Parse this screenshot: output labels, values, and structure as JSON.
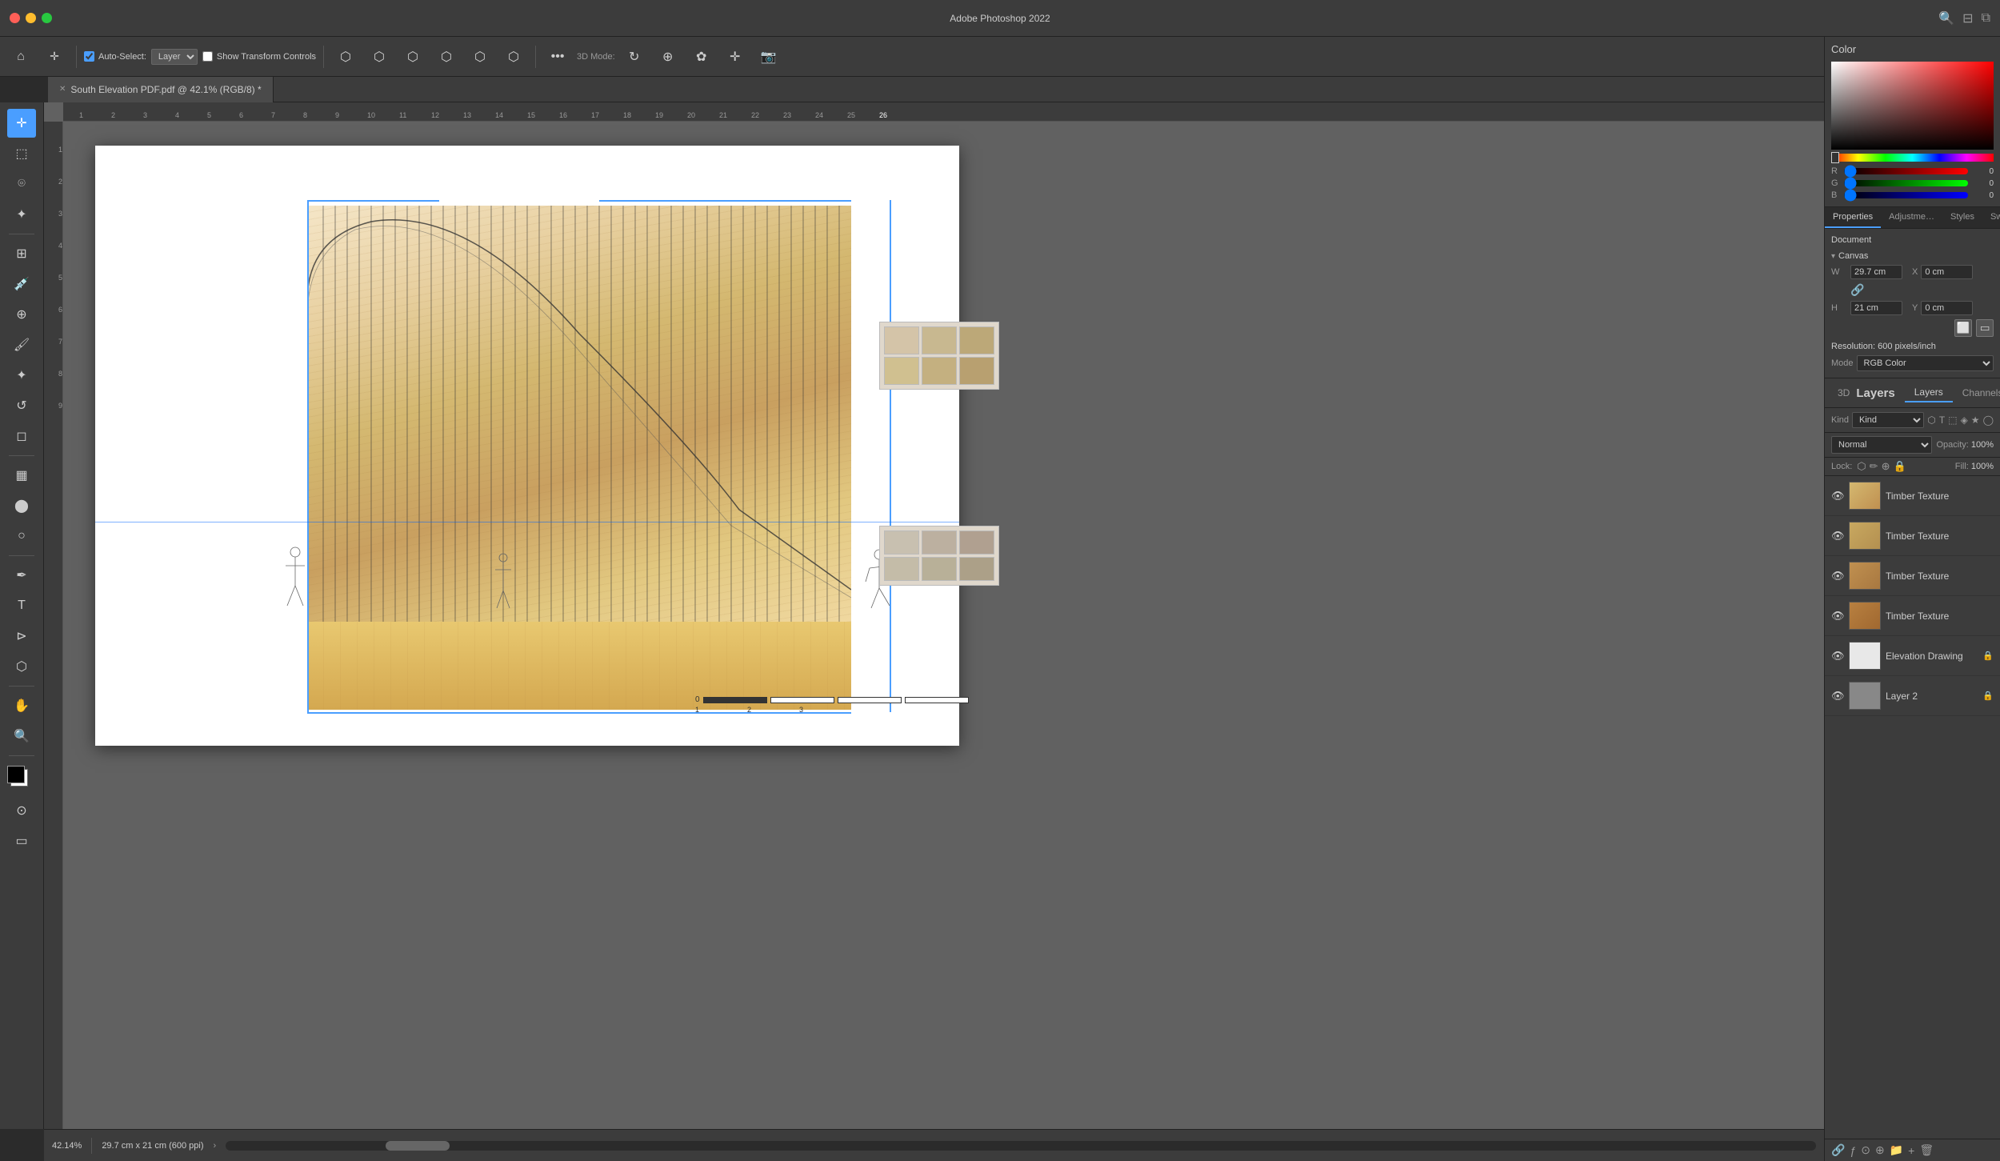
{
  "app": {
    "title": "Adobe Photoshop 2022",
    "document_title": "South Elevation PDF.pdf @ 42.1% (RGB/8) *"
  },
  "toolbar": {
    "auto_select_label": "Auto-Select:",
    "layer_dropdown": "Layer",
    "show_transform_label": "Show Transform Controls",
    "more_icon": "•••",
    "mode_3d": "3D Mode:"
  },
  "color_panel": {
    "title": "Color",
    "r_value": "0",
    "g_value": "0",
    "b_value": "0"
  },
  "properties_panel": {
    "title": "Properties",
    "tabs": [
      "Properties",
      "Adjustme…",
      "Styles",
      "Swatches"
    ],
    "canvas_section": "Canvas",
    "w_label": "W",
    "w_value": "29.7 cm",
    "x_label": "X",
    "x_value": "0 cm",
    "h_label": "H",
    "h_value": "21 cm",
    "y_label": "Y",
    "y_value": "0 cm",
    "resolution_label": "Resolution:",
    "resolution_value": "600 pixels/inch",
    "mode_label": "Mode",
    "mode_value": "RGB Color",
    "document_label": "Document"
  },
  "layers_panel": {
    "title": "Layers",
    "tabs": [
      "3D",
      "Layers",
      "Channels"
    ],
    "filter_label": "Kind",
    "blend_mode": "Normal",
    "opacity_label": "Opacity:",
    "opacity_value": "100%",
    "lock_label": "Lock:",
    "fill_label": "Fill:",
    "fill_value": "100%",
    "layers": [
      {
        "name": "Timber Texture",
        "visible": true,
        "locked": false,
        "thumb_color": "#c8b078"
      },
      {
        "name": "Timber Texture",
        "visible": true,
        "locked": false,
        "thumb_color": "#c8b078"
      },
      {
        "name": "Timber Texture",
        "visible": true,
        "locked": false,
        "thumb_color": "#c8b078"
      },
      {
        "name": "Timber Texture",
        "visible": true,
        "locked": false,
        "thumb_color": "#c8a060"
      },
      {
        "name": "Elevation Drawing",
        "visible": true,
        "locked": true,
        "thumb_color": "#e8e8e8"
      },
      {
        "name": "Layer 2",
        "visible": true,
        "locked": true,
        "thumb_color": "#888"
      }
    ]
  },
  "status_bar": {
    "zoom": "42.14%",
    "dimensions": "29.7 cm x 21 cm (600 ppi)",
    "arrow_label": "›"
  }
}
